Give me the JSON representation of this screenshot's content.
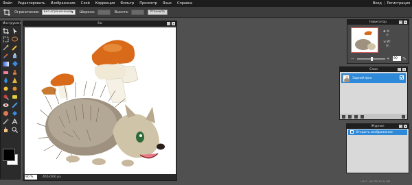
{
  "menu": {
    "items": [
      "Файл",
      "Редактировать",
      "Изображение",
      "Слой",
      "Коррекция",
      "Фильтр",
      "Просмотр",
      "Язык",
      "Справка"
    ],
    "login": "Вход",
    "separator": "|",
    "register": "Регистрация"
  },
  "options": {
    "constraint_label": "Ограничение:",
    "constraint_value": "Без ограничений",
    "width_label": "Ширина:",
    "height_label": "Высота:",
    "refine_button": "Уточнить"
  },
  "toolbox": {
    "title": "Инструмен"
  },
  "document": {
    "title": "ёж",
    "zoom": "90",
    "zoom_unit": "%",
    "dimensions": "465x500 px"
  },
  "navigator": {
    "title": "Навигатор",
    "x_label": "X:",
    "y_label": "Y:",
    "w_label": "W:",
    "h_label": "H:",
    "zoom": "90",
    "zoom_unit": "%"
  },
  "layers": {
    "title": "Слои",
    "items": [
      {
        "name": "Задний фон"
      }
    ]
  },
  "history": {
    "title": "Журнал",
    "items": [
      {
        "label": "Открыть изображение"
      }
    ]
  },
  "status": {
    "fps": "L:817 - 60 FPS 10.04 MB"
  },
  "colors": {
    "accent": "#2e8ad8",
    "menubar": "#1c1c1c",
    "workspace": "#505050"
  }
}
